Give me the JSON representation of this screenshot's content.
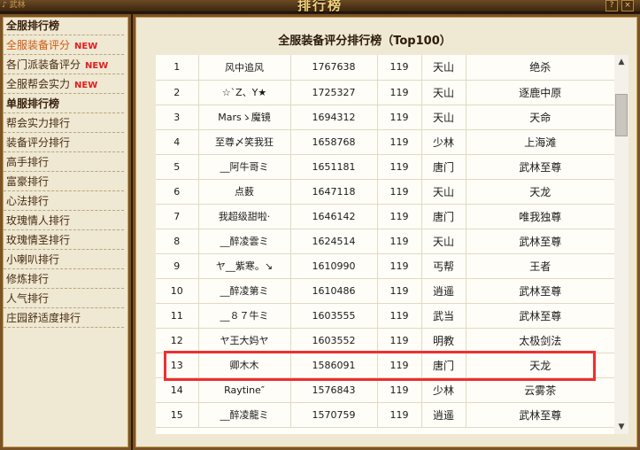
{
  "window": {
    "title": "排行榜",
    "logo_text": "♪ 武林",
    "help_label": "?",
    "close_label": "×"
  },
  "sidebar": {
    "items": [
      {
        "label": "全服排行榜",
        "kind": "header"
      },
      {
        "label": "全服装备评分",
        "kind": "item",
        "active": true,
        "badge": "NEW"
      },
      {
        "label": "各门派装备评分",
        "kind": "item",
        "badge": "NEW"
      },
      {
        "label": "全服帮会实力",
        "kind": "item",
        "badge": "NEW"
      },
      {
        "label": "单服排行榜",
        "kind": "header"
      },
      {
        "label": "帮会实力排行",
        "kind": "item"
      },
      {
        "label": "装备评分排行",
        "kind": "item"
      },
      {
        "label": "高手排行",
        "kind": "item"
      },
      {
        "label": "富豪排行",
        "kind": "item"
      },
      {
        "label": "心法排行",
        "kind": "item"
      },
      {
        "label": "玫瑰情人排行",
        "kind": "item"
      },
      {
        "label": "玫瑰情圣排行",
        "kind": "item"
      },
      {
        "label": "小喇叭排行",
        "kind": "item"
      },
      {
        "label": "修炼排行",
        "kind": "item"
      },
      {
        "label": "人气排行",
        "kind": "item"
      },
      {
        "label": "庄园舒适度排行",
        "kind": "item"
      }
    ]
  },
  "ranking": {
    "title": "全服装备评分排行榜（Top100）",
    "highlighted_rank": "13",
    "rows": [
      {
        "rank": "1",
        "name": "风中追风",
        "score": "1767638",
        "level": "119",
        "school": "天山",
        "title": "绝杀"
      },
      {
        "rank": "2",
        "name": "☆ˋZ、Y★",
        "score": "1725327",
        "level": "119",
        "school": "天山",
        "title": "逐鹿中原"
      },
      {
        "rank": "3",
        "name": "Marsゝ魔镜",
        "score": "1694312",
        "level": "119",
        "school": "天山",
        "title": "天命"
      },
      {
        "rank": "4",
        "name": "至尊〆笑我狂",
        "score": "1658768",
        "level": "119",
        "school": "少林",
        "title": "上海滩"
      },
      {
        "rank": "5",
        "name": "__阿牛哥ミ",
        "score": "1651181",
        "level": "119",
        "school": "唐门",
        "title": "武林至尊"
      },
      {
        "rank": "6",
        "name": "点薮",
        "score": "1647118",
        "level": "119",
        "school": "天山",
        "title": "天龙"
      },
      {
        "rank": "7",
        "name": "我超级甜啦·",
        "score": "1646142",
        "level": "119",
        "school": "唐门",
        "title": "唯我独尊"
      },
      {
        "rank": "8",
        "name": "__醉凌雲ミ",
        "score": "1624514",
        "level": "119",
        "school": "天山",
        "title": "武林至尊"
      },
      {
        "rank": "9",
        "name": "ヤ__紫寒。↘",
        "score": "1610990",
        "level": "119",
        "school": "丐帮",
        "title": "王者"
      },
      {
        "rank": "10",
        "name": "__醉凌第ミ",
        "score": "1610486",
        "level": "119",
        "school": "逍遥",
        "title": "武林至尊"
      },
      {
        "rank": "11",
        "name": "__８７牛ミ",
        "score": "1603555",
        "level": "119",
        "school": "武当",
        "title": "武林至尊"
      },
      {
        "rank": "12",
        "name": "ヤ王大妈ヤ",
        "score": "1603552",
        "level": "119",
        "school": "明教",
        "title": "太极剑法"
      },
      {
        "rank": "13",
        "name": "卿木木",
        "score": "1586091",
        "level": "119",
        "school": "唐门",
        "title": "天龙"
      },
      {
        "rank": "14",
        "name": "Raytine″",
        "score": "1576843",
        "level": "119",
        "school": "少林",
        "title": "云雾茶"
      },
      {
        "rank": "15",
        "name": "__醉凌龍ミ",
        "score": "1570759",
        "level": "119",
        "school": "逍遥",
        "title": "武林至尊"
      }
    ]
  },
  "scrollbar": {
    "up_label": "▲",
    "down_label": "▼"
  }
}
